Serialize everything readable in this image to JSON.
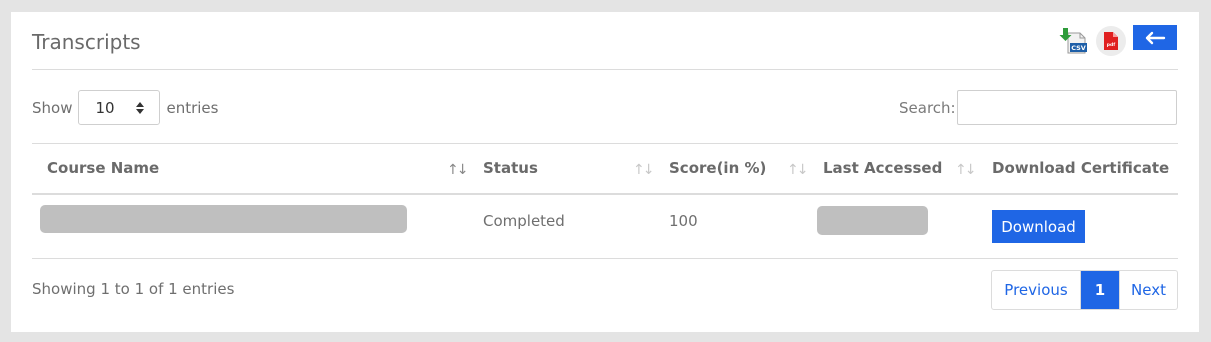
{
  "page": {
    "title": "Transcripts"
  },
  "toolbar": {
    "icons": [
      "csv-export-icon",
      "pdf-export-icon",
      "arrow-left-icon"
    ],
    "accent": "#1f66e5"
  },
  "length": {
    "show_label": "Show",
    "value": "10",
    "entries_label": "entries"
  },
  "search": {
    "label": "Search:"
  },
  "table": {
    "headers": [
      "Course Name",
      "Status",
      "Score(in %)",
      "Last Accessed",
      "Download Certificate"
    ],
    "rows": [
      {
        "status": "Completed",
        "score": "100",
        "action_label": "Download"
      }
    ]
  },
  "footer": {
    "info": "Showing 1 to 1 of 1 entries",
    "pagination": {
      "prev": "Previous",
      "current": "1",
      "next": "Next"
    }
  }
}
